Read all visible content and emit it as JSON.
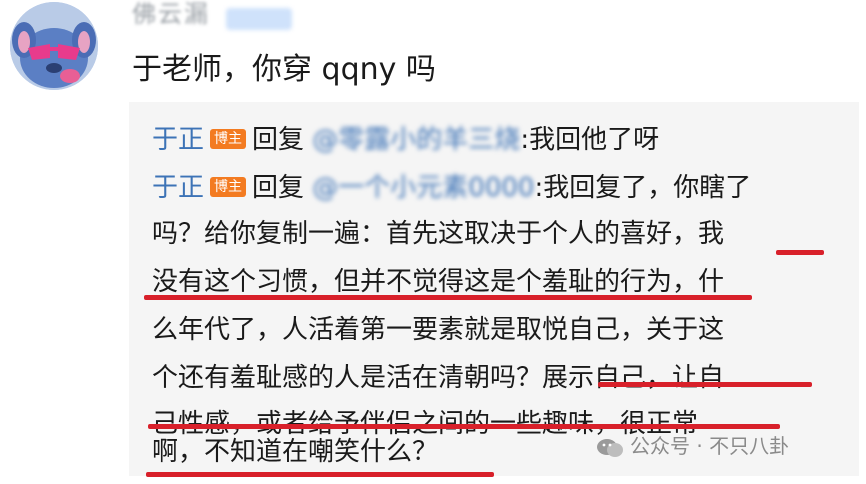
{
  "user": {
    "name": "佛云漏",
    "avatar_icon": "stitch-avatar-icon"
  },
  "comment": {
    "text": "于老师，你穿 qqny 吗"
  },
  "replies": [
    {
      "author": "于正",
      "tag": "博主",
      "action": "回复",
      "mention": "@零露小的羊三烧",
      "content": ":我回他了呀"
    },
    {
      "author": "于正",
      "tag": "博主",
      "action": "回复",
      "mention": "@一个小元素0000",
      "content": ":我回复了，你瞎了"
    }
  ],
  "body_lines": [
    "吗？给你复制一遍：首先这取决于个人的喜好，我",
    "没有这个习惯，但并不觉得这是个羞耻的行为，什",
    "么年代了，人活着第一要素就是取悦自己，关于这",
    "个还有羞耻感的人是活在清朝吗？展示自己，让自",
    "己性感，或者给予伴侣之间的一些趣味，很正常",
    "啊，不知道在嘲笑什么？"
  ],
  "colors": {
    "author": "#3d73b6",
    "tag_bg": "#f37b21",
    "underline": "#d8202a",
    "reply_bg": "#f5f5f5"
  },
  "watermark": {
    "text": "公众号 · 不只八卦",
    "icon": "wechat-icon"
  }
}
